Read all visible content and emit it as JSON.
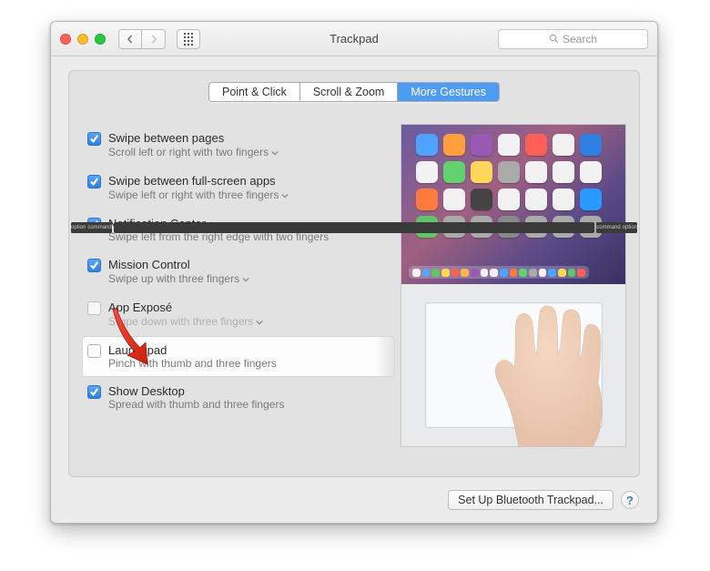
{
  "window": {
    "title": "Trackpad"
  },
  "toolbar": {
    "search_placeholder": "Search"
  },
  "tabs": [
    "Point & Click",
    "Scroll & Zoom",
    "More Gestures"
  ],
  "active_tab": 2,
  "options": [
    {
      "checked": true,
      "title": "Swipe between pages",
      "sub": "Scroll left or right with two fingers",
      "dropdown": true
    },
    {
      "checked": true,
      "title": "Swipe between full-screen apps",
      "sub": "Swipe left or right with three fingers",
      "dropdown": true
    },
    {
      "checked": true,
      "title": "Notification Center",
      "sub": "Swipe left from the right edge with two fingers",
      "dropdown": false
    },
    {
      "checked": true,
      "title": "Mission Control",
      "sub": "Swipe up with three fingers",
      "dropdown": true
    },
    {
      "checked": false,
      "title": "App Exposé",
      "sub": "Swipe down with three fingers",
      "dropdown": true,
      "dim": true
    },
    {
      "checked": false,
      "title": "Launchpad",
      "sub": "Pinch with thumb and three fingers",
      "dropdown": false,
      "highlight": true
    },
    {
      "checked": true,
      "title": "Show Desktop",
      "sub": "Spread with thumb and three fingers",
      "dropdown": false
    }
  ],
  "footer": {
    "button": "Set Up Bluetooth Trackpad...",
    "help": "?"
  },
  "key_labels": {
    "cmd": "command",
    "opt": "option"
  },
  "app_colors": [
    "#4da3ff",
    "#ff9f3d",
    "#9b59b6",
    "#f2f2f2",
    "#ff5f57",
    "#f2f2f2",
    "#2d7fe2",
    "#f2f2f2",
    "#62d26f",
    "#ffd658",
    "#aaaaaa",
    "#f2f2f2",
    "#f2f2f2",
    "#f2f2f2",
    "#ff7a3d",
    "#f2f2f2",
    "#444444",
    "#f2f2f2",
    "#f2f2f2",
    "#f2f2f2",
    "#299aff",
    "#60c46a",
    "#aaaaaa",
    "#aaaaaa",
    "#888888",
    "#aaaaaa",
    "#aaaaaa",
    "#aaaaaa"
  ],
  "dock_colors": [
    "#f2f2f2",
    "#5aa6f6",
    "#60c46a",
    "#ffd658",
    "#ff5f57",
    "#ffb74d",
    "#9b59b6",
    "#f2f2f2",
    "#f2f2f2",
    "#4da3ff",
    "#ff7a3d",
    "#62d26f",
    "#aaaaaa",
    "#f2f2f2",
    "#4da3ff",
    "#ffd658",
    "#60c46a",
    "#ff5f57"
  ]
}
